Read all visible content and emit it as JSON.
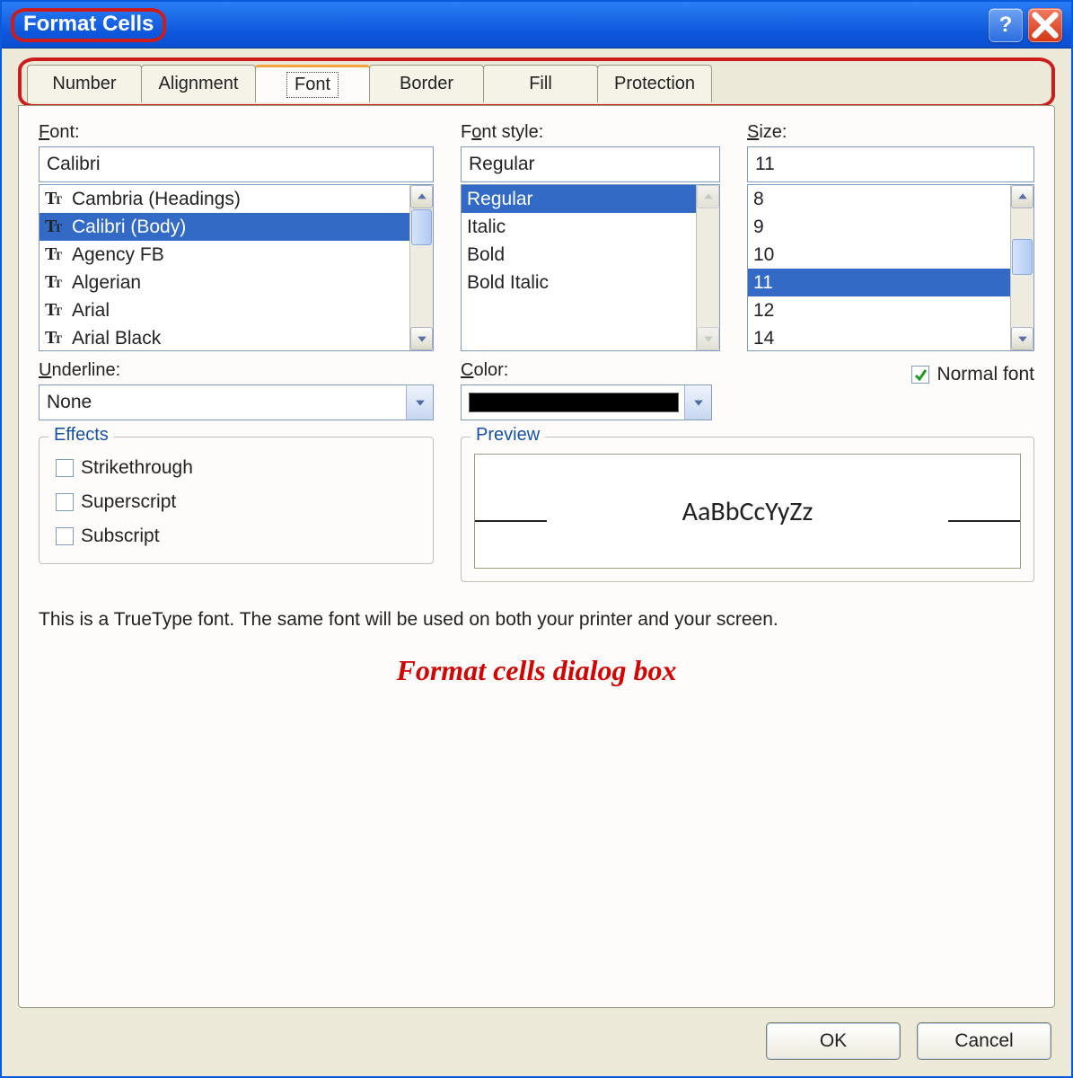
{
  "window": {
    "title": "Format Cells"
  },
  "tabs": {
    "items": [
      "Number",
      "Alignment",
      "Font",
      "Border",
      "Fill",
      "Protection"
    ],
    "active_index": 2
  },
  "font": {
    "label": "Font:",
    "value": "Calibri",
    "list": [
      "Cambria (Headings)",
      "Calibri (Body)",
      "Agency FB",
      "Algerian",
      "Arial",
      "Arial Black"
    ],
    "selected_index": 1
  },
  "font_style": {
    "label": "Font style:",
    "value": "Regular",
    "list": [
      "Regular",
      "Italic",
      "Bold",
      "Bold Italic"
    ],
    "selected_index": 0
  },
  "size": {
    "label": "Size:",
    "value": "11",
    "list": [
      "8",
      "9",
      "10",
      "11",
      "12",
      "14"
    ],
    "selected_index": 3
  },
  "underline": {
    "label": "Underline:",
    "value": "None"
  },
  "color": {
    "label": "Color:",
    "swatch_hex": "#000000"
  },
  "normal_font": {
    "label": "Normal font",
    "checked": true
  },
  "effects": {
    "legend": "Effects",
    "items": [
      {
        "label": "Strikethrough",
        "checked": false
      },
      {
        "label": "Superscript",
        "checked": false
      },
      {
        "label": "Subscript",
        "checked": false
      }
    ]
  },
  "preview": {
    "legend": "Preview",
    "sample": "AaBbCcYyZz"
  },
  "note": "This is a TrueType font.  The same font will be used on both your printer and your screen.",
  "caption": "Format cells dialog box",
  "buttons": {
    "ok": "OK",
    "cancel": "Cancel"
  }
}
